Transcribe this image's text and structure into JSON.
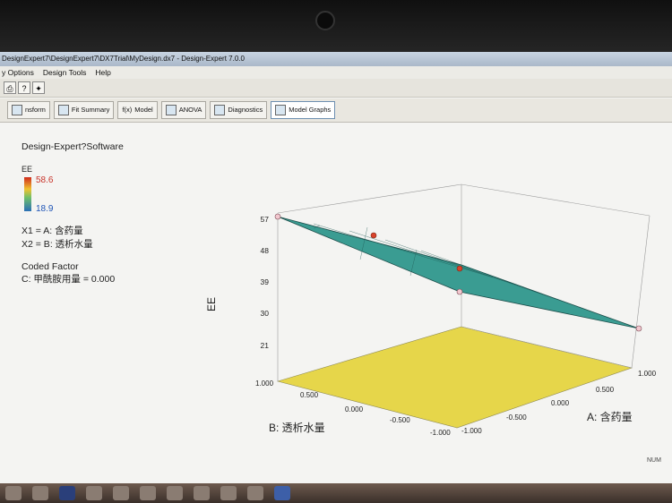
{
  "window": {
    "title": "DesignExpert7\\DesignExpert7\\DX7Trial\\MyDesign.dx7 - Design-Expert 7.0.0",
    "menu": [
      "y Options",
      "Design Tools",
      "Help"
    ]
  },
  "tabs": [
    {
      "label": "nsform",
      "icon": "transform-icon"
    },
    {
      "label": "Fit Summary",
      "icon": "fit-summary-icon"
    },
    {
      "label": "Model",
      "icon": "model-icon",
      "prefix": "f(x)"
    },
    {
      "label": "ANOVA",
      "icon": "anova-icon"
    },
    {
      "label": "Diagnostics",
      "icon": "diagnostics-icon"
    },
    {
      "label": "Model Graphs",
      "icon": "model-graphs-icon",
      "active": true
    }
  ],
  "info": {
    "software": "Design-Expert?Software",
    "response": "EE",
    "legend_max": "58.6",
    "legend_min": "18.9",
    "x1": "X1 = A: 含药量",
    "x2": "X2 = B: 透析水量",
    "coded_factor_title": "Coded Factor",
    "coded_factor": "C: 甲酰胺用量 = 0.000"
  },
  "chart_data": {
    "type": "surface3d",
    "zlabel": "EE",
    "xlabel": "A: 含药量",
    "ylabel": "B: 透析水量",
    "z_ticks": [
      "57",
      "48",
      "39",
      "30",
      "21"
    ],
    "a_ticks": [
      "1.000",
      "0.500",
      "0.000",
      "-0.500",
      "-1.000"
    ],
    "b_ticks": [
      "1.000",
      "0.500",
      "0.000",
      "-0.500",
      "-1.000"
    ],
    "corner_values": {
      "A-1_B1": 57,
      "A1_B1": 40,
      "A-1_B-1": 42,
      "A1_B-1": 21
    },
    "colors": {
      "surface": "#2f8f8a",
      "floor": "#e8d84a"
    }
  },
  "status": {
    "num_label": "NUM"
  }
}
